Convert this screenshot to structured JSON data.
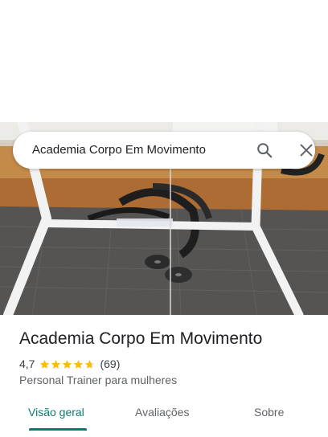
{
  "search": {
    "query": "Academia Corpo Em Movimento",
    "search_icon": "search-icon",
    "close_icon": "close-icon"
  },
  "place": {
    "name": "Academia Corpo Em Movimento",
    "rating": "4,7",
    "rating_stars": 4.7,
    "reviews": "(69)",
    "category": "Personal Trainer para mulheres"
  },
  "tabs": [
    {
      "label": "Visão geral",
      "active": true
    },
    {
      "label": "Avaliações",
      "active": false
    },
    {
      "label": "Sobre",
      "active": false
    }
  ],
  "colors": {
    "accent": "#0b7a6f",
    "star": "#fbbc04"
  }
}
